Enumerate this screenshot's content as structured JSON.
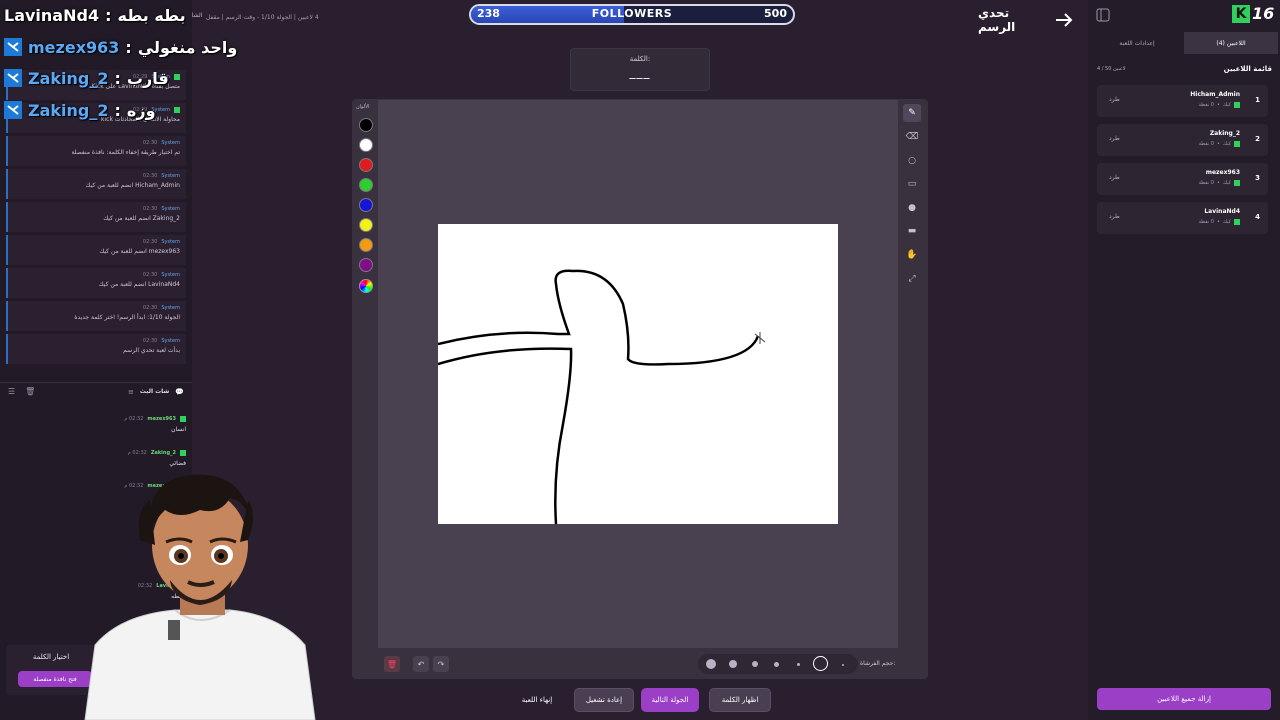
{
  "stream_overlay": {
    "lines": [
      {
        "name": "LavinaNd4",
        "message": "بطه بطه"
      },
      {
        "name": "mezex963",
        "message": "واحد منغولي"
      },
      {
        "name": "Zaking_2",
        "message": "قارب"
      },
      {
        "name": "Zaking_2",
        "message": "وزه"
      }
    ]
  },
  "system_log": {
    "header_fragment": "الشا",
    "items": [
      {
        "sender": "System",
        "time": "02:29",
        "text": "متصل بقناة LavinaNd4 على Kick"
      },
      {
        "sender": "System",
        "time": "02:29",
        "text": "محاولة الاتصال بالمحادثات kick"
      },
      {
        "sender": "System",
        "time": "02:30",
        "text": "تم اختيار طريقة إخفاء الكلمة: نافذة منفصلة"
      },
      {
        "sender": "System",
        "time": "02:30",
        "text": "Hicham_Admin انضم للعبة من كيك"
      },
      {
        "sender": "System",
        "time": "02:30",
        "text": "Zaking_2 انضم للعبة من كيك"
      },
      {
        "sender": "System",
        "time": "02:30",
        "text": "mezex963 انضم للعبة من كيك"
      },
      {
        "sender": "System",
        "time": "02:30",
        "text": "LavinaNd4 انضم للعبة من كيك"
      },
      {
        "sender": "System",
        "time": "02:30",
        "text": "الجولة 1/10: ابدأ الرسم! اختر كلمة جديدة"
      },
      {
        "sender": "System",
        "time": "02:30",
        "text": "بدأت لعبة تحدي الرسم"
      }
    ]
  },
  "live_chat": {
    "title": "شات البث",
    "items": [
      {
        "user": "mezex963",
        "time": "02:32 م",
        "text": "انسان"
      },
      {
        "user": "Zaking_2",
        "time": "02:32 م",
        "text": "فضائي"
      },
      {
        "user": "mezex963",
        "time": "02:32 م",
        "text": ""
      },
      {
        "user": "LavinaNd4",
        "time": "02:32",
        "text": "ه بطه"
      }
    ]
  },
  "word_choice": {
    "title": "اختيار الكلمة",
    "button": "فتح نافذة منفصلة"
  },
  "top_bar": {
    "followers_label": "FOLLOWERS",
    "followers_current": "238",
    "followers_goal": "500",
    "followers_progress": 0.476,
    "info_text": "4 لاعبين  |  الجولة 1/10 - وقت الرسم  |  مقفل",
    "page_title": "تحدي الرسم"
  },
  "word_box": {
    "label": "الكلمة:",
    "value": "___"
  },
  "canvas": {
    "palette_label": "الألوان",
    "colors": [
      "#000000",
      "#ffffff",
      "#e01b1b",
      "#2ccf2c",
      "#1515d8",
      "#f2f21a",
      "#f29a12",
      "#7d0e86"
    ],
    "brush_size_label": "حجم الفرشاة:",
    "tools": [
      "pencil-icon",
      "eraser-icon",
      "circle-icon",
      "rectangle-icon",
      "fill-icon",
      "line-icon",
      "pan-icon",
      "expand-icon"
    ]
  },
  "actions": {
    "end_game": "إنهاء اللعبة",
    "restart": "إعادة تشغيل",
    "next_round": "الجولة التالية",
    "show_word": "اظهار الكلمة"
  },
  "right_panel": {
    "logo": "16",
    "tab_players": "اللاعبين (4)",
    "tab_settings": "إعدادات اللعبة",
    "list_title": "قائمة اللاعبين",
    "list_count": "4 / 50 لاعبين",
    "kick_label": "طرد",
    "players": [
      {
        "rank": "1",
        "name": "Hicham_Admin",
        "platform": "كيك",
        "points": "0 نقطة"
      },
      {
        "rank": "2",
        "name": "Zaking_2",
        "platform": "كيك",
        "points": "0 نقطة"
      },
      {
        "rank": "3",
        "name": "mezex963",
        "platform": "كيك",
        "points": "0 نقطة"
      },
      {
        "rank": "4",
        "name": "LavinaNd4",
        "platform": "كيك",
        "points": "0 نقطة"
      }
    ],
    "remove_all_button": "إزالة جميع اللاعبين"
  }
}
